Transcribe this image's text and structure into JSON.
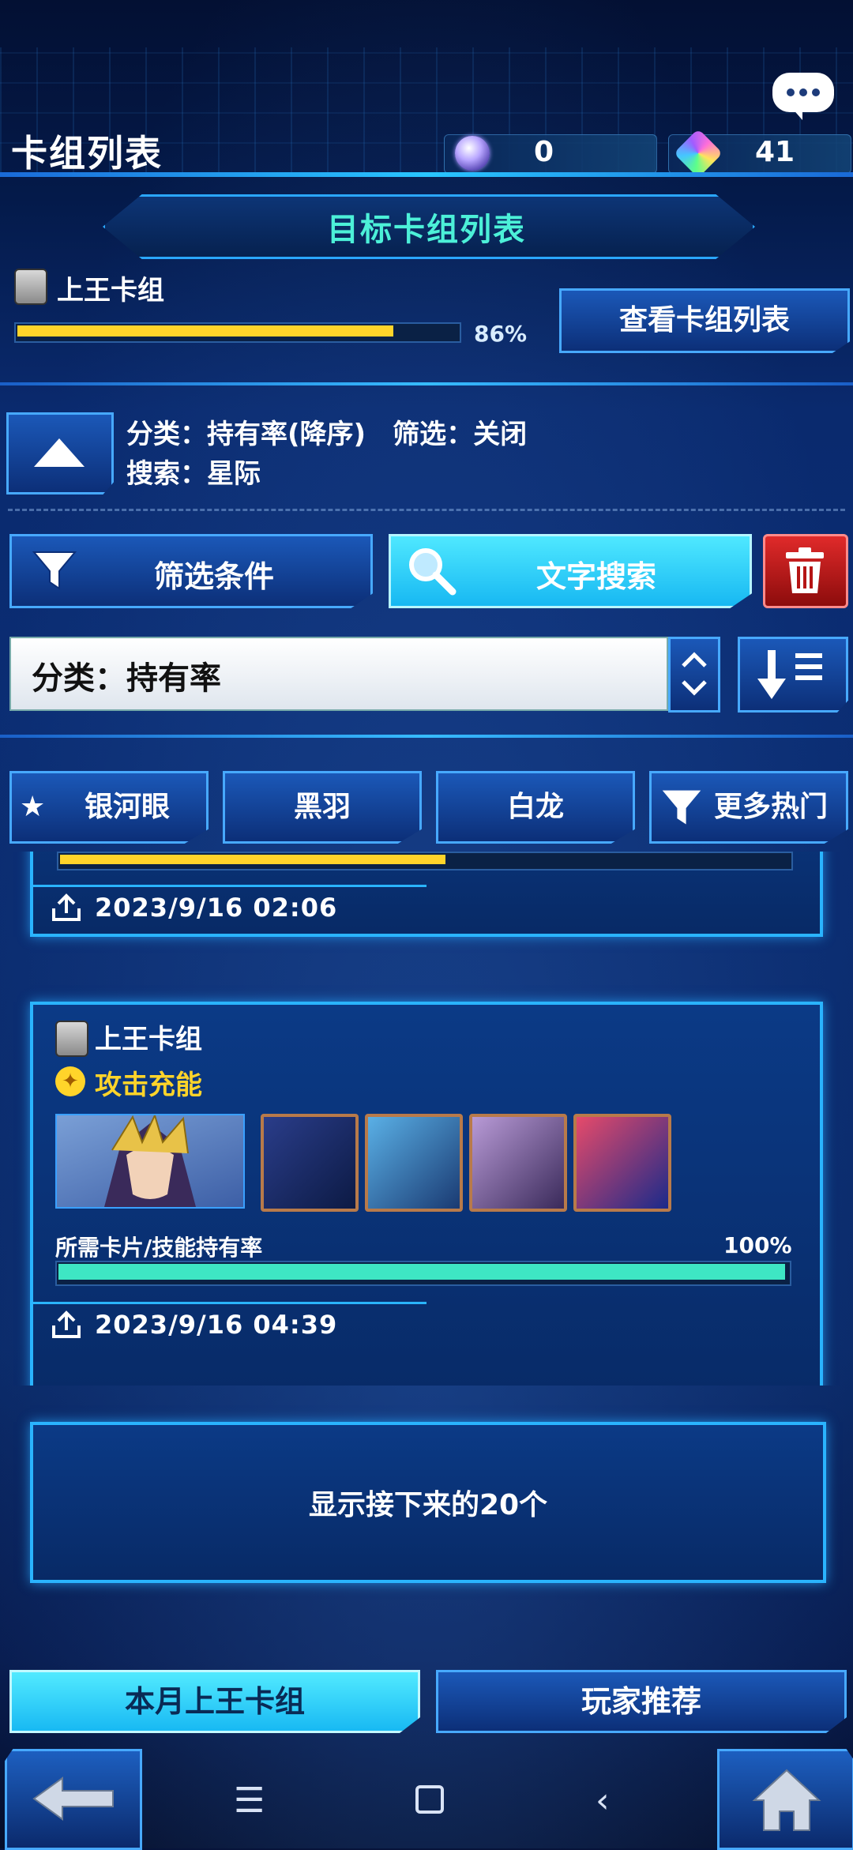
{
  "header": {
    "title": "卡组列表",
    "currency1": "0",
    "currency2": "41"
  },
  "target": {
    "label": "目标卡组列表",
    "deck_name": "上王卡组",
    "progress_pct": "86%",
    "progress_value": 0.86,
    "view_button": "查看卡组列表"
  },
  "sort": {
    "line1": "分类：持有率(降序)　筛选：关闭",
    "line2": "搜索：星际"
  },
  "buttons": {
    "filter": "筛选条件",
    "text_search": "文字搜索"
  },
  "select": {
    "value": "分类：持有率"
  },
  "chips": [
    {
      "label": "银河眼"
    },
    {
      "label": "黑羽"
    },
    {
      "label": "白龙"
    },
    {
      "label": "更多热门"
    }
  ],
  "deck_cards": [
    {
      "date": "2023/9/16 02:06",
      "progress_value": 0.53
    },
    {
      "deck_name": "上王卡组",
      "skill": "攻击充能",
      "rate_label": "所需卡片/技能持有率",
      "rate_pct": "100%",
      "progress_value": 1.0,
      "date": "2023/9/16 04:39"
    }
  ],
  "next_button": "显示接下来的20个",
  "tabs": {
    "left": "本月上王卡组",
    "right": "玩家推荐"
  },
  "colors": {
    "accent": "#2ab4ff",
    "cyan_button": "#4fe8ff",
    "progress_yellow": "#ffd42a",
    "progress_teal": "#3ee6c4",
    "trash_red": "#c81e1e"
  }
}
